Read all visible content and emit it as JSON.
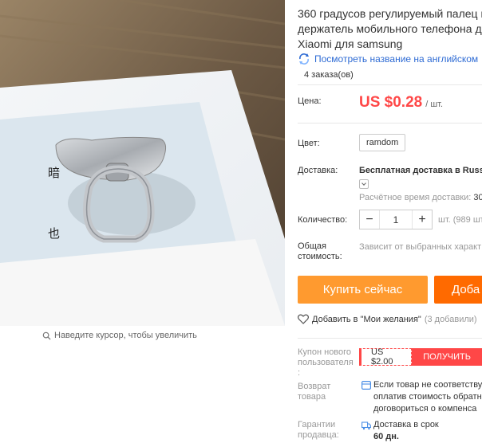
{
  "product": {
    "title_lines": [
      "360 градусов регулируемый палец к",
      "держатель мобильного телефона де",
      "Xiaomi для samsung"
    ],
    "translate_link": "Посмотреть название на английском",
    "orders": "4 заказа(ов)"
  },
  "price": {
    "label": "Цена:",
    "amount": "US $0.28",
    "unit": "/ шт."
  },
  "color": {
    "label": "Цвет:",
    "option": "ramdom"
  },
  "shipping": {
    "label": "Доставка:",
    "method": "Бесплатная доставка в Russ",
    "time_label": "Расчётное время доставки:",
    "time_value": "30"
  },
  "quantity": {
    "label": "Количество:",
    "value": "1",
    "minus": "−",
    "plus": "+",
    "available": "шт. (989 шт"
  },
  "total": {
    "label_line1": "Общая",
    "label_line2": "стоимость:",
    "value": "Зависит от выбранных характ"
  },
  "actions": {
    "buy_now": "Купить сейчас",
    "add_to_cart": "Доба"
  },
  "wishlist": {
    "label": "Добавить в \"Мои желания\"",
    "count": "(3 добавили)"
  },
  "coupon": {
    "label_lines": [
      "Купон нового",
      "пользователя",
      ":"
    ],
    "value": "US $2.00",
    "button": "ПОЛУЧИТЬ"
  },
  "returns": {
    "label_lines": [
      "Возврат",
      "товара"
    ],
    "text_lines": [
      "Если товар не соответству",
      "оплатив стоимость обратн",
      "договориться о компенса"
    ]
  },
  "guarantee": {
    "label_lines": [
      "Гарантии",
      "продавца:"
    ],
    "text_line1": "Доставка в срок",
    "text_line2": "60 дн."
  },
  "image": {
    "zoom_hint": "Наведите курсор, чтобы увеличить"
  },
  "colors": {
    "price_red": "#ff4747",
    "buy_orange": "#ff9a2f",
    "cart_orange": "#ff6a00",
    "link_blue": "#2e6bd4"
  }
}
